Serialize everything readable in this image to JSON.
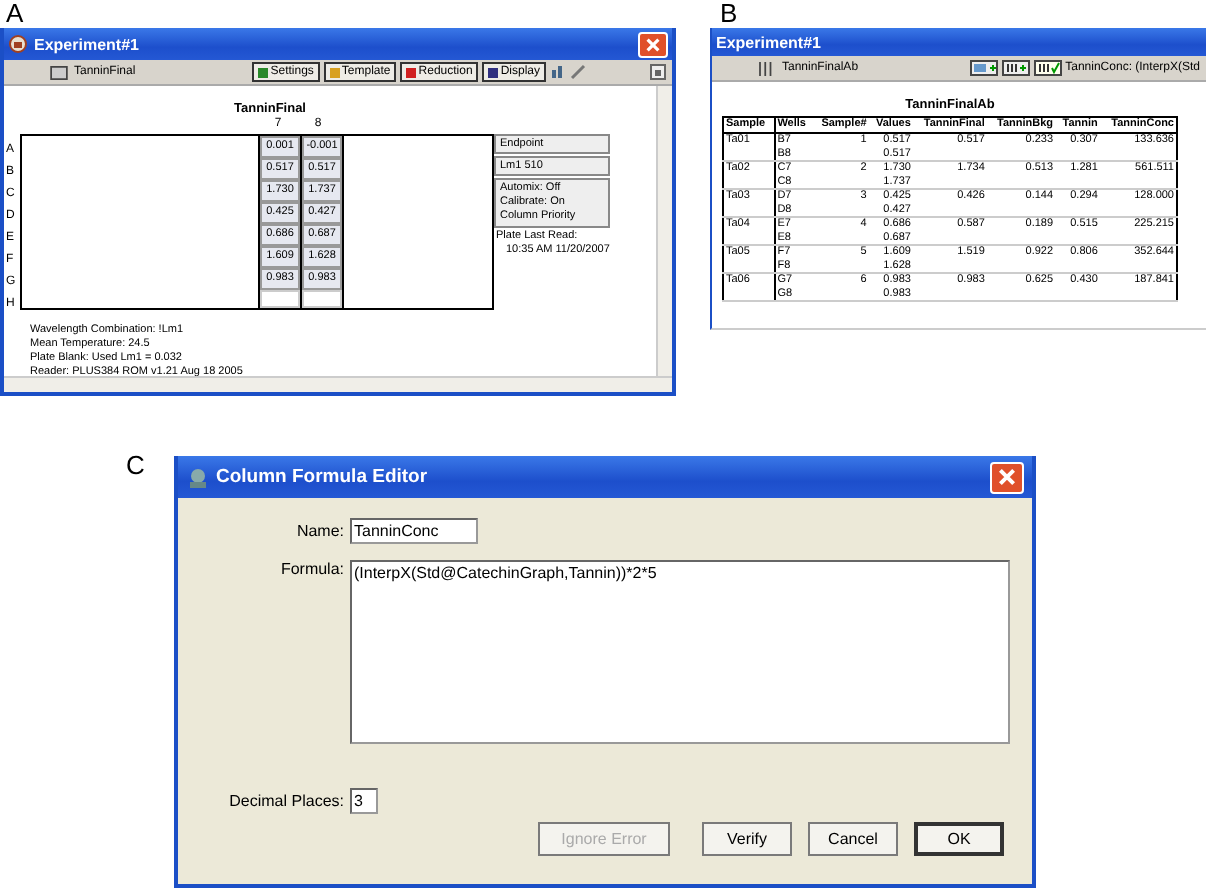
{
  "panel_a": {
    "label": "A",
    "window_title": "Experiment#1",
    "section_tab": "TanninFinal",
    "toolbar_buttons": [
      {
        "label": "Settings",
        "kind": "settings"
      },
      {
        "label": "Template",
        "kind": "template"
      },
      {
        "label": "Reduction",
        "kind": "reduction"
      },
      {
        "label": "Display",
        "kind": "display"
      }
    ],
    "plate": {
      "title": "TanninFinal",
      "columns": [
        "7",
        "8"
      ],
      "rows": [
        {
          "letter": "A",
          "values": [
            "0.001",
            "-0.001"
          ]
        },
        {
          "letter": "B",
          "values": [
            "0.517",
            "0.517"
          ]
        },
        {
          "letter": "C",
          "values": [
            "1.730",
            "1.737"
          ]
        },
        {
          "letter": "D",
          "values": [
            "0.425",
            "0.427"
          ]
        },
        {
          "letter": "E",
          "values": [
            "0.686",
            "0.687"
          ]
        },
        {
          "letter": "F",
          "values": [
            "1.609",
            "1.628"
          ]
        },
        {
          "letter": "G",
          "values": [
            "0.983",
            "0.983"
          ]
        },
        {
          "letter": "H",
          "values": []
        }
      ]
    },
    "side_panel": {
      "mode": "Endpoint",
      "wavelength": "Lm1  510",
      "settings": [
        "Automix: Off",
        "Calibrate: On",
        "Column Priority"
      ],
      "last_read_label": "Plate Last Read:",
      "last_read_time": "10:35 AM  11/20/2007"
    },
    "footer_lines": [
      "Wavelength Combination: !Lm1",
      "Mean Temperature: 24.5",
      "Plate Blank: Used   Lm1 = 0.032",
      "Reader: PLUS384 ROM v1.21 Aug 18 2005"
    ]
  },
  "panel_b": {
    "label": "B",
    "window_title": "Experiment#1",
    "section_tab": "TanninFinalAb",
    "formula_preview": "TanninConc: (InterpX(Std",
    "table": {
      "title": "TanninFinalAb",
      "columns": [
        "Sample",
        "Wells",
        "Sample#",
        "Values",
        "TanninFinal",
        "TanninBkg",
        "Tannin",
        "TanninConc"
      ],
      "rows": [
        {
          "cells": [
            [
              "Ta01"
            ],
            [
              "B7",
              "B8"
            ],
            [
              "1"
            ],
            [
              "0.517",
              "0.517"
            ],
            [
              "0.517"
            ],
            [
              "0.233"
            ],
            [
              "0.307"
            ],
            [
              "133.636"
            ]
          ]
        },
        {
          "cells": [
            [
              "Ta02"
            ],
            [
              "C7",
              "C8"
            ],
            [
              "2"
            ],
            [
              "1.730",
              "1.737"
            ],
            [
              "1.734"
            ],
            [
              "0.513"
            ],
            [
              "1.281"
            ],
            [
              "561.511"
            ]
          ]
        },
        {
          "cells": [
            [
              "Ta03"
            ],
            [
              "D7",
              "D8"
            ],
            [
              "3"
            ],
            [
              "0.425",
              "0.427"
            ],
            [
              "0.426"
            ],
            [
              "0.144"
            ],
            [
              "0.294"
            ],
            [
              "128.000"
            ]
          ]
        },
        {
          "cells": [
            [
              "Ta04"
            ],
            [
              "E7",
              "E8"
            ],
            [
              "4"
            ],
            [
              "0.686",
              "0.687"
            ],
            [
              "0.587"
            ],
            [
              "0.189"
            ],
            [
              "0.515"
            ],
            [
              "225.215"
            ]
          ]
        },
        {
          "cells": [
            [
              "Ta05"
            ],
            [
              "F7",
              "F8"
            ],
            [
              "5"
            ],
            [
              "1.609",
              "1.628"
            ],
            [
              "1.519"
            ],
            [
              "0.922"
            ],
            [
              "0.806"
            ],
            [
              "352.644"
            ]
          ]
        },
        {
          "cells": [
            [
              "Ta06"
            ],
            [
              "G7",
              "G8"
            ],
            [
              "6"
            ],
            [
              "0.983",
              "0.983"
            ],
            [
              "0.983"
            ],
            [
              "0.625"
            ],
            [
              "0.430"
            ],
            [
              "187.841"
            ]
          ]
        }
      ]
    }
  },
  "panel_c": {
    "label": "C",
    "window_title": "Column Formula Editor",
    "name_label": "Name:",
    "name_value": "TanninConc",
    "formula_label": "Formula:",
    "formula_value": "(InterpX(Std@CatechinGraph,Tannin))*2*5",
    "decimal_label": "Decimal Places:",
    "decimal_value": "3",
    "buttons": [
      {
        "label": "Ignore Error",
        "disabled": true,
        "default": false
      },
      {
        "label": "Verify",
        "disabled": false,
        "default": false
      },
      {
        "label": "Cancel",
        "disabled": false,
        "default": false
      },
      {
        "label": "OK",
        "disabled": false,
        "default": true
      }
    ]
  }
}
